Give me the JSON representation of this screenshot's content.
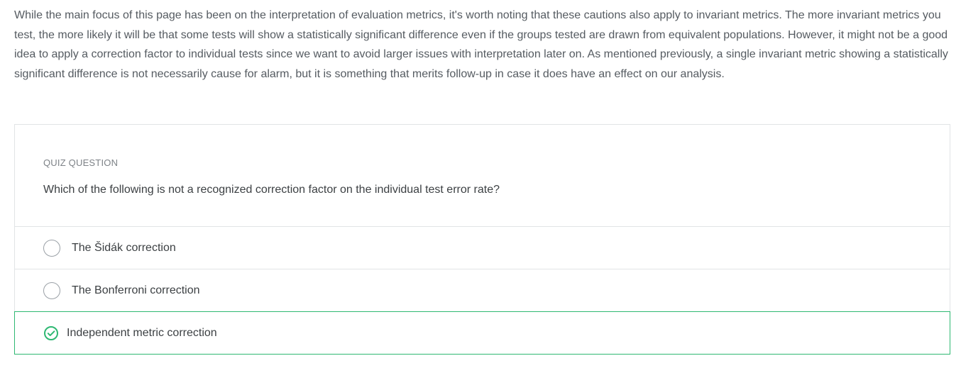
{
  "intro": {
    "paragraph": "While the main focus of this page has been on the interpretation of evaluation metrics, it's worth noting that these cautions also apply to invariant metrics. The more invariant metrics you test, the more likely it will be that some tests will show a statistically significant difference even if the groups tested are drawn from equivalent populations. However, it might not be a good idea to apply a correction factor to individual tests since we want to avoid larger issues with interpretation later on. As mentioned previously, a single invariant metric showing a statistically significant difference is not necessarily cause for alarm, but it is something that merits follow-up in case it does have an effect on our analysis."
  },
  "quiz": {
    "label": "QUIZ QUESTION",
    "question": "Which of the following is not a recognized correction factor on the individual test error rate?",
    "options": [
      {
        "label": "The Šidák correction",
        "state": "unselected"
      },
      {
        "label": "The Bonferroni correction",
        "state": "unselected"
      },
      {
        "label": "Independent metric correction",
        "state": "correct"
      }
    ]
  },
  "colors": {
    "correct": "#2eb872",
    "border": "#e1e4e6",
    "text": "#3c4043"
  },
  "icons": {
    "correct": "check-circle-icon",
    "unselected": "radio-circle-icon"
  }
}
